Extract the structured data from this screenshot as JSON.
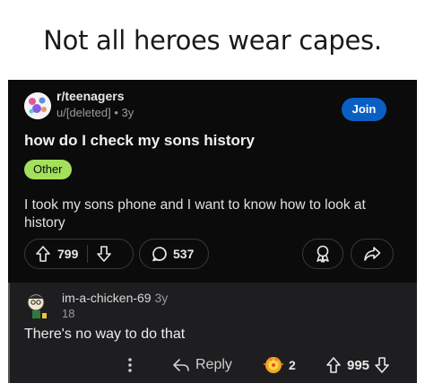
{
  "caption": "Not all heroes wear capes.",
  "post": {
    "subreddit": "r/teenagers",
    "author": "u/[deleted]",
    "age": "3y",
    "join_label": "Join",
    "title": "how do I check my sons history",
    "flair": "Other",
    "body": "I took my sons phone and I want to know how to look at history",
    "upvotes": "799",
    "comments": "537",
    "colors": {
      "background": "#0b0b0b",
      "join": "#0a5fc4",
      "flair": "#a3e05b"
    }
  },
  "comment": {
    "username": "im-a-chicken-69",
    "age": "3y",
    "karma": "18",
    "text": "There's no way to do that",
    "reply_label": "Reply",
    "award_count": "2",
    "votes": "995",
    "colors": {
      "background": "#1e1e20"
    }
  },
  "icons": [
    "subreddit-avatar-icon",
    "arrow-up-icon",
    "arrow-down-icon",
    "comment-bubble-icon",
    "award-icon",
    "share-icon",
    "more-dots-icon",
    "reply-arrow-icon",
    "gold-award-icon",
    "user-avatar-icon"
  ]
}
